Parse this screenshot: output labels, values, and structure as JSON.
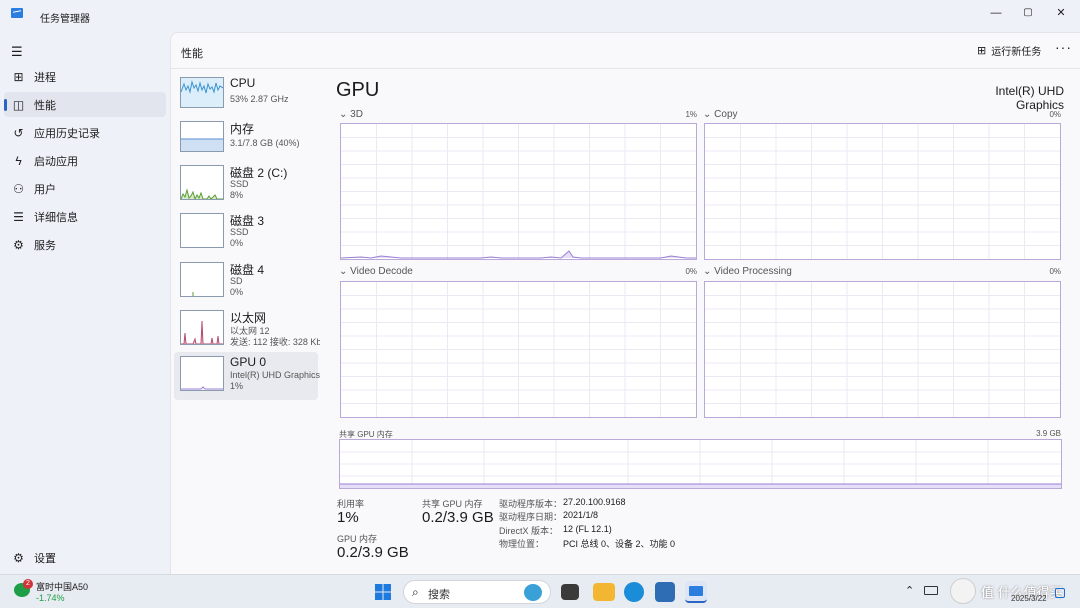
{
  "app": {
    "title": "任务管理器",
    "minimize": "—",
    "maximize": "▢",
    "close": "✕"
  },
  "nav": {
    "items": [
      {
        "label": "进程",
        "icon": "processes-icon",
        "glyph": "⊞"
      },
      {
        "label": "性能",
        "icon": "performance-icon",
        "glyph": "◫"
      },
      {
        "label": "应用历史记录",
        "icon": "history-icon",
        "glyph": "↺"
      },
      {
        "label": "启动应用",
        "icon": "startup-icon",
        "glyph": "⚡"
      },
      {
        "label": "用户",
        "icon": "users-icon",
        "glyph": "⚇"
      },
      {
        "label": "详细信息",
        "icon": "details-icon",
        "glyph": "☰"
      },
      {
        "label": "服务",
        "icon": "services-icon",
        "glyph": "⚙"
      }
    ],
    "settings": {
      "label": "设置",
      "icon": "settings-icon",
      "glyph": "⚙"
    },
    "active": "性能"
  },
  "header": {
    "title": "性能",
    "run_task": "运行新任务",
    "more": "···"
  },
  "devices": [
    {
      "name": "CPU",
      "sub1": "53% 2.87 GHz",
      "sub2": "",
      "sub3": ""
    },
    {
      "name": "内存",
      "sub1": "3.1/7.8 GB (40%)",
      "sub2": "",
      "sub3": ""
    },
    {
      "name": "磁盘 2 (C:)",
      "sub1": "SSD",
      "sub2": "8%",
      "sub3": ""
    },
    {
      "name": "磁盘 3",
      "sub1": "SSD",
      "sub2": "0%",
      "sub3": ""
    },
    {
      "name": "磁盘 4",
      "sub1": "SD",
      "sub2": "0%",
      "sub3": ""
    },
    {
      "name": "以太网",
      "sub1": "以太网 12",
      "sub2": "发送: 112 接收: 328 Kbps",
      "sub3": ""
    },
    {
      "name": "GPU 0",
      "sub1": "Intel(R) UHD Graphics",
      "sub2": "1%",
      "sub3": ""
    }
  ],
  "gpu": {
    "title": "GPU",
    "model": "Intel(R) UHD Graphics",
    "engines": [
      {
        "name": "3D",
        "pct": "1%"
      },
      {
        "name": "Copy",
        "pct": "0%"
      },
      {
        "name": "Video Decode",
        "pct": "0%"
      },
      {
        "name": "Video Processing",
        "pct": "0%"
      }
    ],
    "shared_label": "共享 GPU 内存",
    "shared_max": "3.9 GB",
    "stats": {
      "util_label": "利用率",
      "util_val": "1%",
      "shared_label": "共享 GPU 内存",
      "shared_val": "0.2/3.9 GB",
      "gpu_mem_label": "GPU 内存",
      "gpu_mem_val": "0.2/3.9 GB"
    },
    "details": [
      {
        "k": "驱动程序版本：",
        "v": "27.20.100.9168"
      },
      {
        "k": "驱动程序日期：",
        "v": "2021/1/8"
      },
      {
        "k": "DirectX 版本：",
        "v": "12 (FL 12.1)"
      },
      {
        "k": "物理位置：",
        "v": "PCI 总线 0、设备 2、功能 0"
      }
    ]
  },
  "taskbar": {
    "stock_name": "富时中国A50",
    "stock_change": "-1.74%",
    "badge": "2",
    "search_placeholder": "搜索",
    "date": "2025/3/22",
    "watermark": "值 什么值得买"
  },
  "colors": {
    "accent": "#2b63c6",
    "gpu": "#9a7fd4",
    "cpu": "#4aa3d6",
    "disk": "#5a9e32",
    "net": "#b44a6e",
    "stock_down": "#1e9e46"
  }
}
